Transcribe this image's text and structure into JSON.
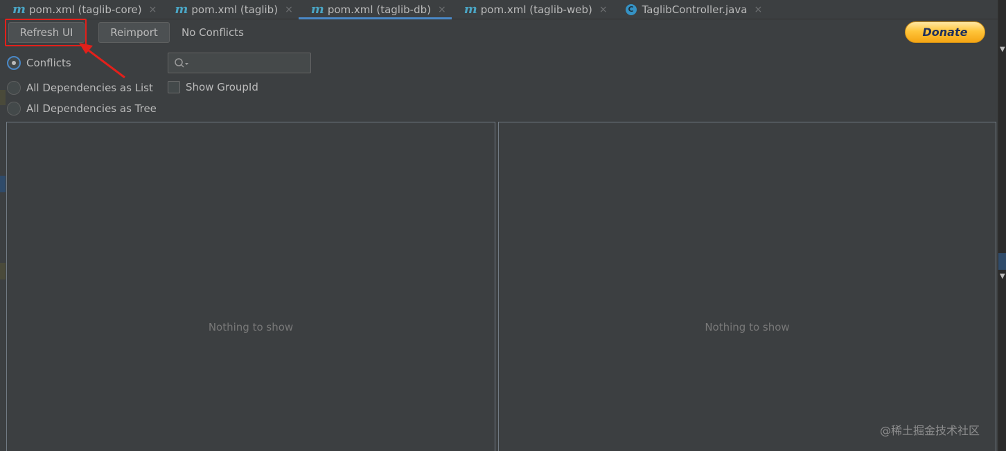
{
  "tabs": [
    {
      "icon": "maven-m-icon",
      "glyph": "m",
      "label": "pom.xml (taglib-core)",
      "close": "×",
      "active": false
    },
    {
      "icon": "maven-m-icon",
      "glyph": "m",
      "label": "pom.xml (taglib)",
      "close": "×",
      "active": false
    },
    {
      "icon": "maven-m-icon",
      "glyph": "m",
      "label": "pom.xml (taglib-db)",
      "close": "×",
      "active": true
    },
    {
      "icon": "maven-m-icon",
      "glyph": "m",
      "label": "pom.xml (taglib-web)",
      "close": "×",
      "active": false
    },
    {
      "icon": "java-class-icon",
      "glyph": "C",
      "label": "TaglibController.java",
      "close": "×",
      "active": false
    }
  ],
  "toolbar": {
    "refresh_label": "Refresh UI",
    "reimport_label": "Reimport",
    "status": "No Conflicts",
    "donate_label": "Donate"
  },
  "view_mode": {
    "options": [
      {
        "label": "Conflicts",
        "checked": true
      },
      {
        "label": "All Dependencies as List",
        "checked": false
      },
      {
        "label": "All Dependencies as Tree",
        "checked": false
      }
    ]
  },
  "search": {
    "placeholder": "",
    "value": ""
  },
  "show_group_id": {
    "label": "Show GroupId",
    "checked": false
  },
  "panels": {
    "left_empty": "Nothing to show",
    "right_empty": "Nothing to show"
  },
  "watermark": "@稀土掘金技术社区",
  "colors": {
    "background": "#3c3f41",
    "accent": "#4a88c7",
    "highlight": "#e3201b",
    "donate": "#ffc53a"
  }
}
